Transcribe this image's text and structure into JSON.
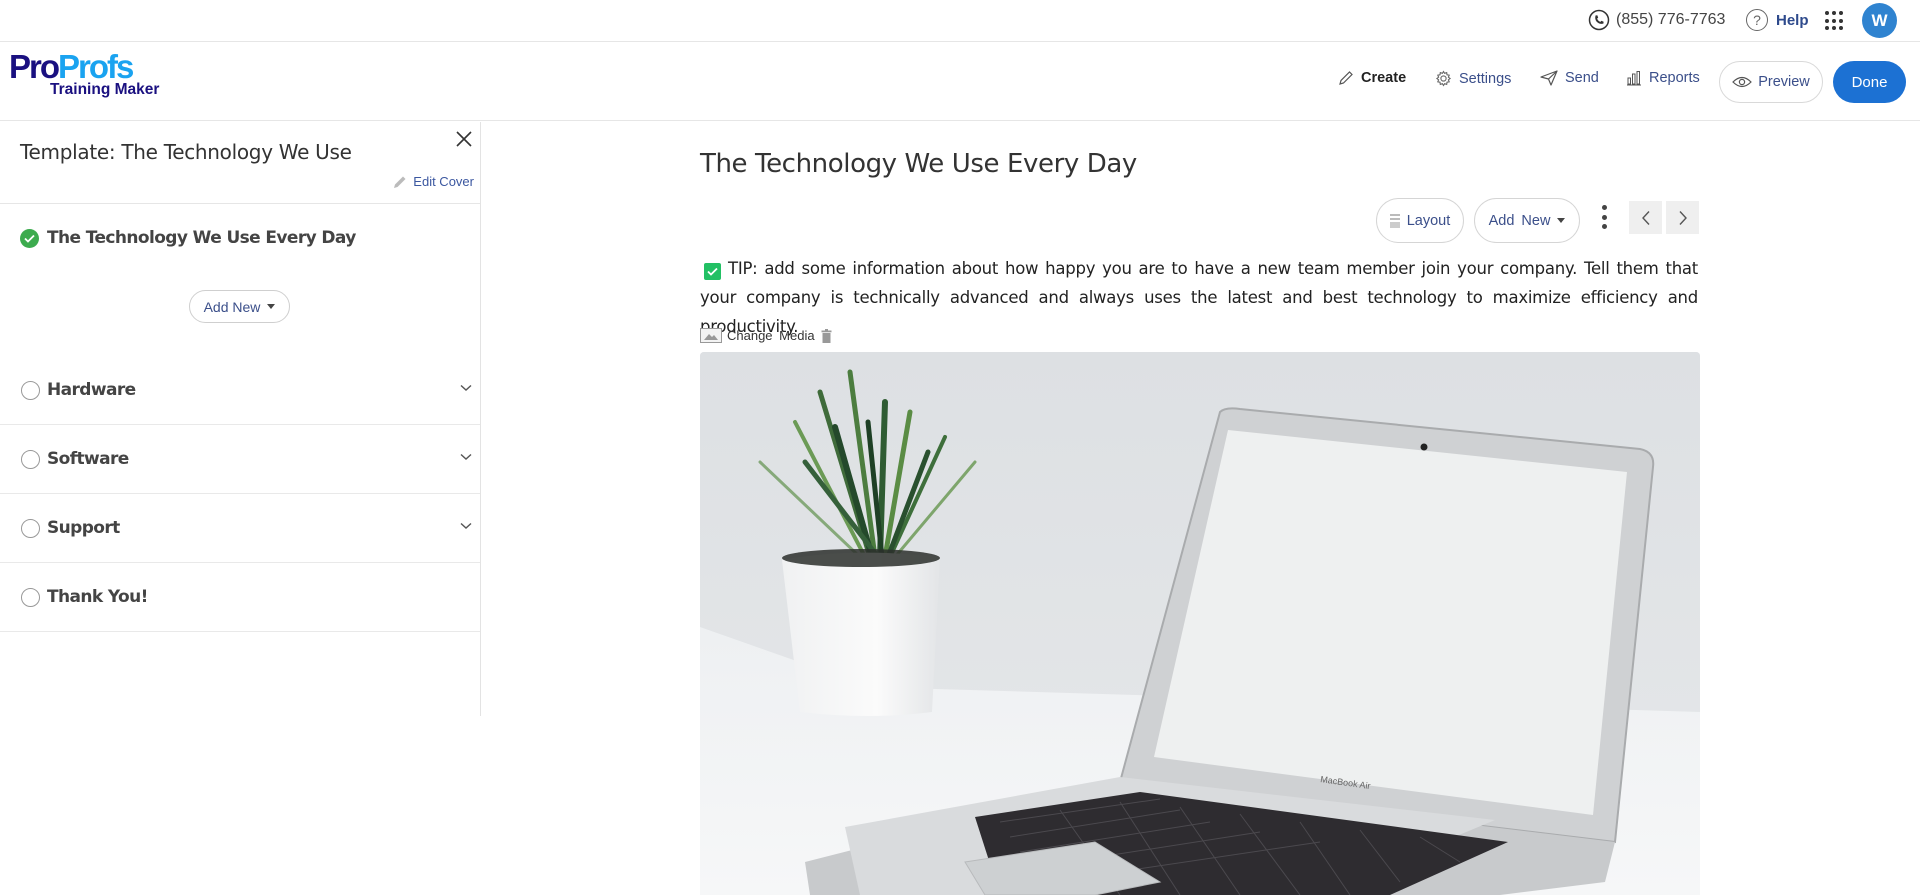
{
  "topbar": {
    "phone": "(855) 776-7763",
    "help_label": "Help",
    "avatar_initial": "W"
  },
  "header": {
    "logo": {
      "pro": "Pro",
      "profs": "Profs",
      "subtitle": "Training Maker"
    },
    "nav": [
      {
        "label": "Create",
        "icon": "pencil-icon",
        "active": true
      },
      {
        "label": "Settings",
        "icon": "gear-icon",
        "active": false
      },
      {
        "label": "Send",
        "icon": "send-icon",
        "active": false
      },
      {
        "label": "Reports",
        "icon": "bar-chart-icon",
        "active": false
      }
    ],
    "preview_label": "Preview",
    "done_label": "Done"
  },
  "sidebar": {
    "title": "Template: The Technology We Use",
    "edit_cover_label": "Edit Cover",
    "active_item": "The Technology We Use Every Day",
    "add_new_label": "Add New",
    "items": [
      {
        "label": "Hardware",
        "expandable": true
      },
      {
        "label": "Software",
        "expandable": true
      },
      {
        "label": "Support",
        "expandable": true
      },
      {
        "label": "Thank You!",
        "expandable": false
      }
    ]
  },
  "main": {
    "title": "The Technology We Use Every Day",
    "toolbar": {
      "layout_label": "Layout",
      "add_new_label": "Add New"
    },
    "tip_text": "TIP: add some information about how happy you are to have a new team member join your company. Tell them that your company is technically advanced and always uses the latest and best technology to maximize efficiency and productivity.",
    "media": {
      "change_label": "Change Media",
      "image_alt": "MacBook Air laptop on white desk beside a potted plant",
      "laptop_brand_text": "MacBook Air"
    }
  },
  "colors": {
    "brand_dark": "#1a1080",
    "brand_light": "#1aa3f0",
    "primary_button": "#1c71d3",
    "link": "#3b4f8a",
    "success": "#3cab4e",
    "tip_check": "#22c064",
    "avatar": "#2f83d0"
  }
}
